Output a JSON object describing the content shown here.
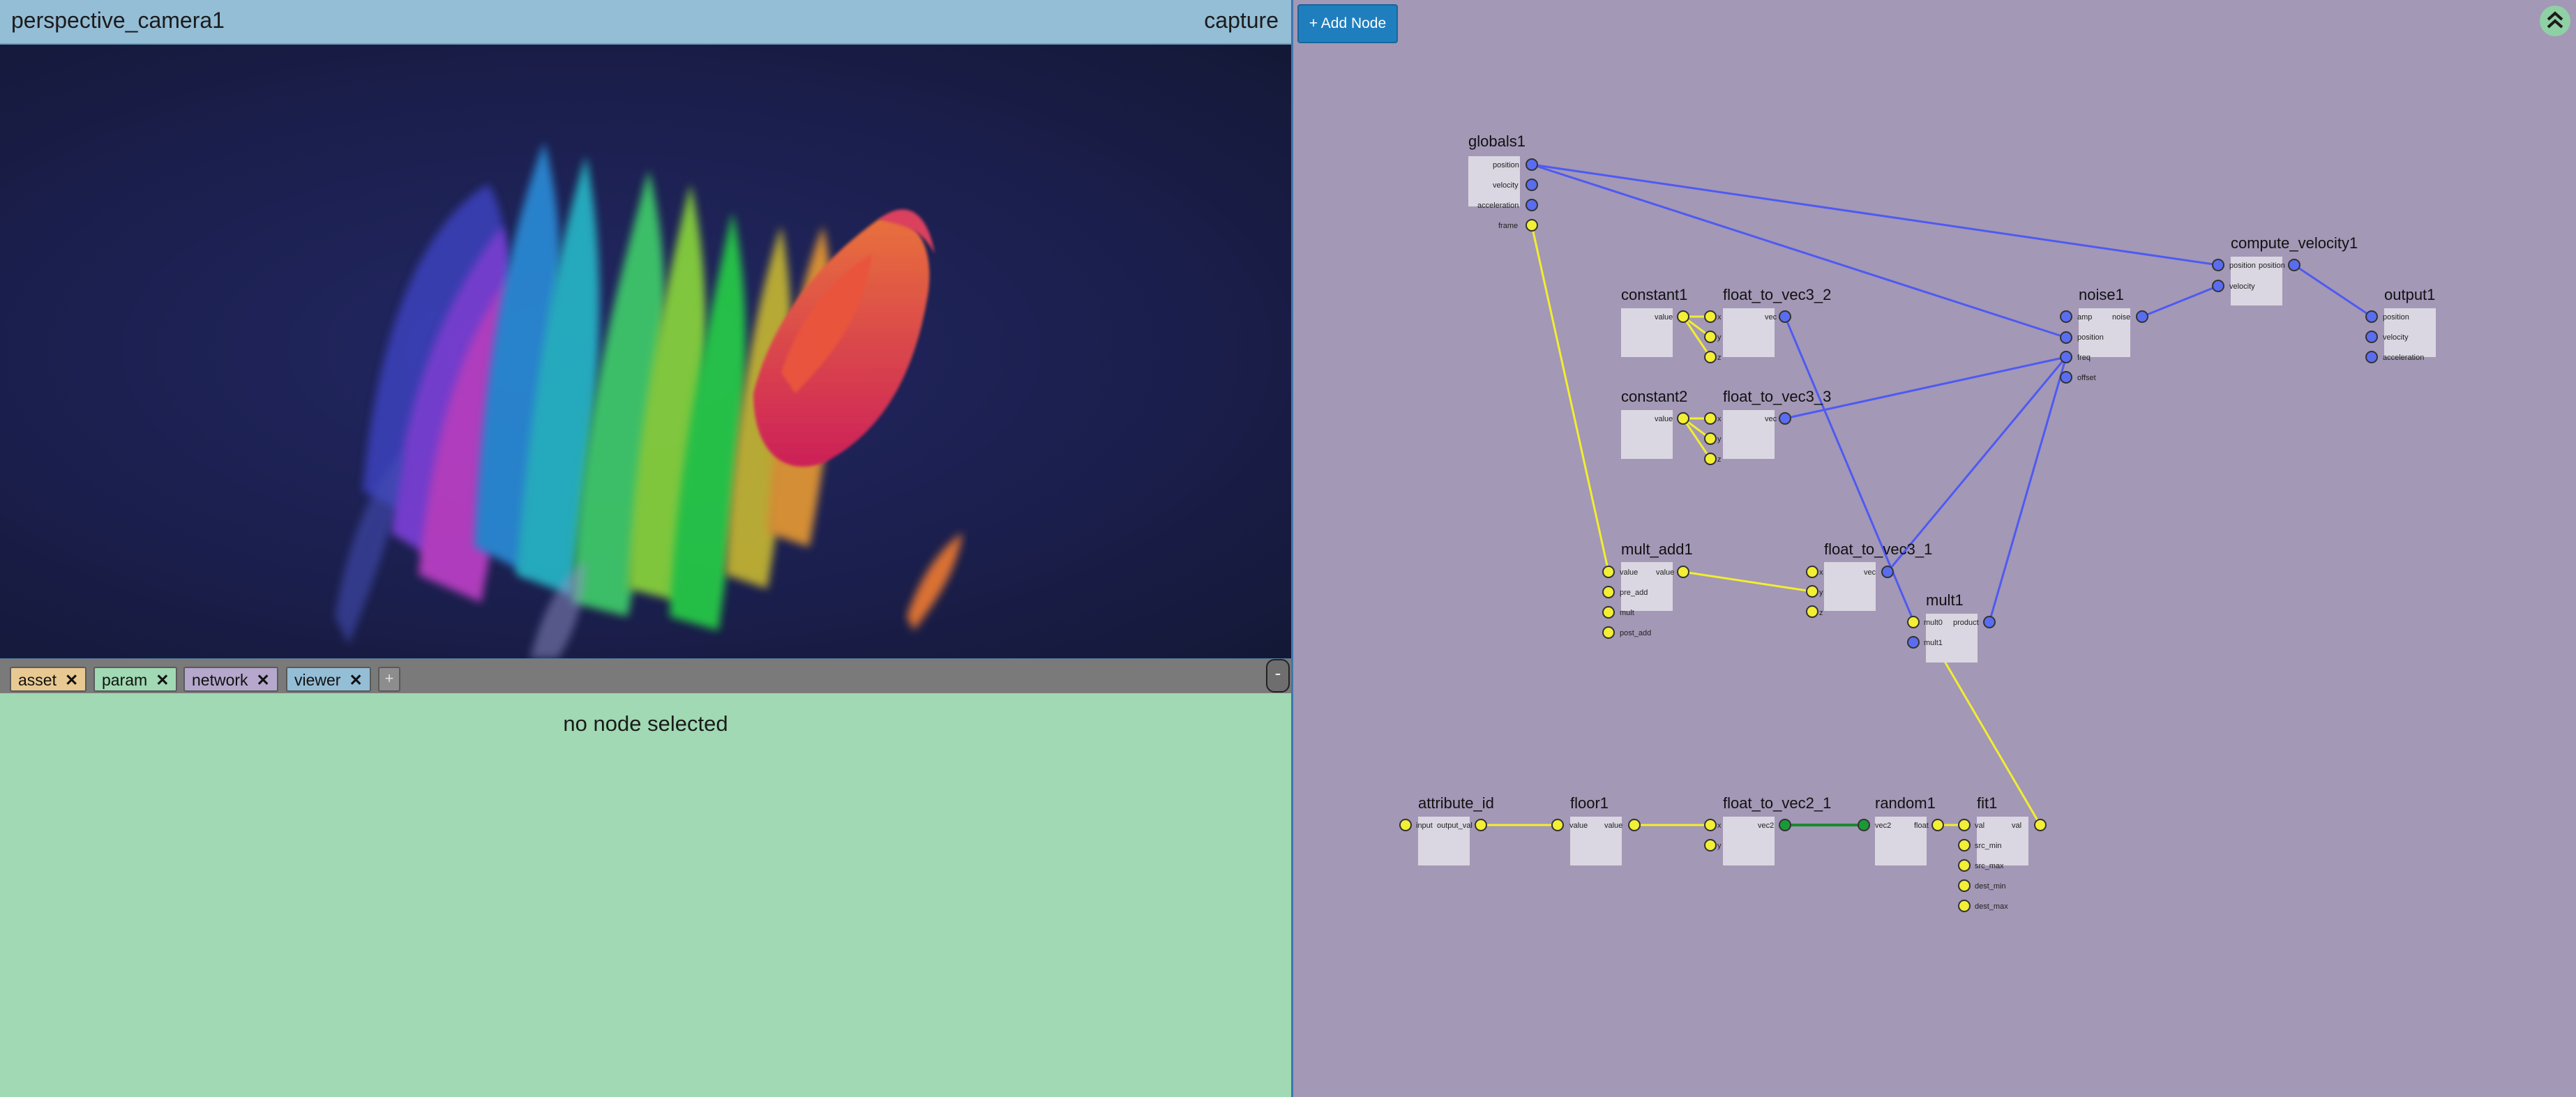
{
  "viewer": {
    "title": "perspective_camera1",
    "capture_label": "capture"
  },
  "tabs": [
    {
      "label": "asset",
      "close": "✕",
      "color": "#e8c992"
    },
    {
      "label": "param",
      "close": "✕",
      "color": "#a0d9b3"
    },
    {
      "label": "network",
      "close": "✕",
      "color": "#b5a8cc"
    },
    {
      "label": "viewer",
      "close": "✕",
      "color": "#94bdd6"
    }
  ],
  "tab_add_label": "+",
  "collapse_label": "-",
  "param_panel": {
    "empty_text": "no node selected"
  },
  "network": {
    "add_node_label": "+ Add Node",
    "collapse_icon": "double-chevron-up-icon",
    "nodes": {
      "globals1": {
        "title": "globals1",
        "ports": [
          "position",
          "velocity",
          "acceleration",
          "frame"
        ]
      },
      "constant1": {
        "title": "constant1",
        "ports": [
          "value"
        ]
      },
      "constant2": {
        "title": "constant2",
        "ports": [
          "value"
        ]
      },
      "float_to_vec3_2": {
        "title": "float_to_vec3_2",
        "ports": [
          "x",
          "y",
          "z",
          "vec"
        ]
      },
      "float_to_vec3_3": {
        "title": "float_to_vec3_3",
        "ports": [
          "x",
          "y",
          "z",
          "vec"
        ]
      },
      "noise1": {
        "title": "noise1",
        "ports": [
          "amp",
          "position",
          "freq",
          "offset",
          "noise"
        ]
      },
      "compute_velocity1": {
        "title": "compute_velocity1",
        "ports": [
          "position",
          "velocity",
          "position"
        ]
      },
      "output1": {
        "title": "output1",
        "ports": [
          "position",
          "velocity",
          "acceleration"
        ]
      },
      "mult_add1": {
        "title": "mult_add1",
        "ports": [
          "value",
          "pre_add",
          "mult",
          "post_add",
          "value"
        ]
      },
      "float_to_vec3_1": {
        "title": "float_to_vec3_1",
        "ports": [
          "x",
          "y",
          "z",
          "vec"
        ]
      },
      "mult1": {
        "title": "mult1",
        "ports": [
          "mult0",
          "mult1",
          "product"
        ]
      },
      "attribute_id": {
        "title": "attribute_id",
        "ports": [
          "input",
          "output_val"
        ]
      },
      "floor1": {
        "title": "floor1",
        "ports": [
          "value",
          "value"
        ]
      },
      "float_to_vec2_1": {
        "title": "float_to_vec2_1",
        "ports": [
          "x",
          "y",
          "vec2"
        ]
      },
      "random1": {
        "title": "random1",
        "ports": [
          "vec2",
          "float"
        ]
      },
      "fit1": {
        "title": "fit1",
        "ports": [
          "val",
          "src_min",
          "src_max",
          "dest_min",
          "dest_max",
          "val"
        ]
      }
    }
  }
}
